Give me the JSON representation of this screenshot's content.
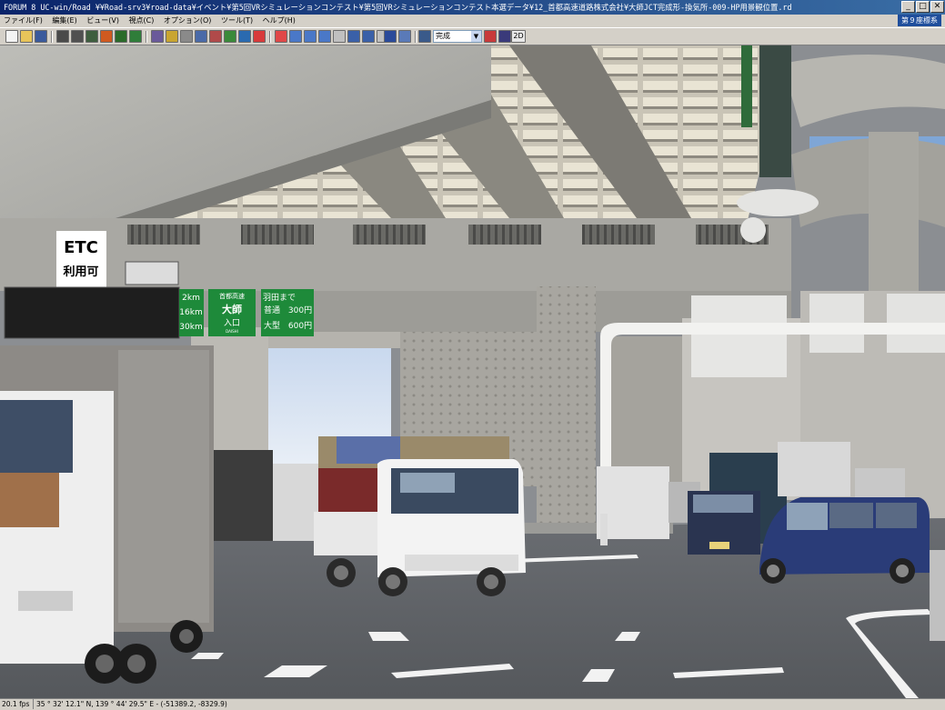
{
  "window": {
    "title": "FORUM 8   UC-win/Road    ¥¥Road-srv3¥road-data¥イベント¥第5回VRシミュレーションコンテスト¥第5回VRシミュレーションコンテスト本選データ¥12_首都高速道路株式会社¥大師JCT完成形-換気所-009-HP用景観位置.rd",
    "minimize_glyph": "_",
    "maximize_glyph": "□",
    "close_glyph": "✕"
  },
  "menu": {
    "items": [
      "ファイル(F)",
      "編集(E)",
      "ビュー(V)",
      "視点(C)",
      "オプション(O)",
      "ツール(T)",
      "ヘルプ(H)"
    ],
    "coord_badge": "第９座標系"
  },
  "toolbar": {
    "display_mode": "完成",
    "view_2d": "2D"
  },
  "scene": {
    "etc_sign_line1": "ETC",
    "etc_sign_line2": "利用可",
    "green_sign_left_1": "2km",
    "green_sign_left_2": "16km",
    "green_sign_left_3": "30km",
    "entrance_header": "首都高速",
    "entrance_name": "大師",
    "entrance_label": "入口",
    "entrance_sub": "DAISHI",
    "toll_header": "羽田まで",
    "toll_row1_label": "普通",
    "toll_row1_value": "300円",
    "toll_row2_label": "大型",
    "toll_row2_value": "600円"
  },
  "status": {
    "fps": "20.1 fps",
    "position": "35 °  32' 12.1\" N, 139 °  44' 29.5\" E  -  (-51389.2, -8329.9)"
  }
}
